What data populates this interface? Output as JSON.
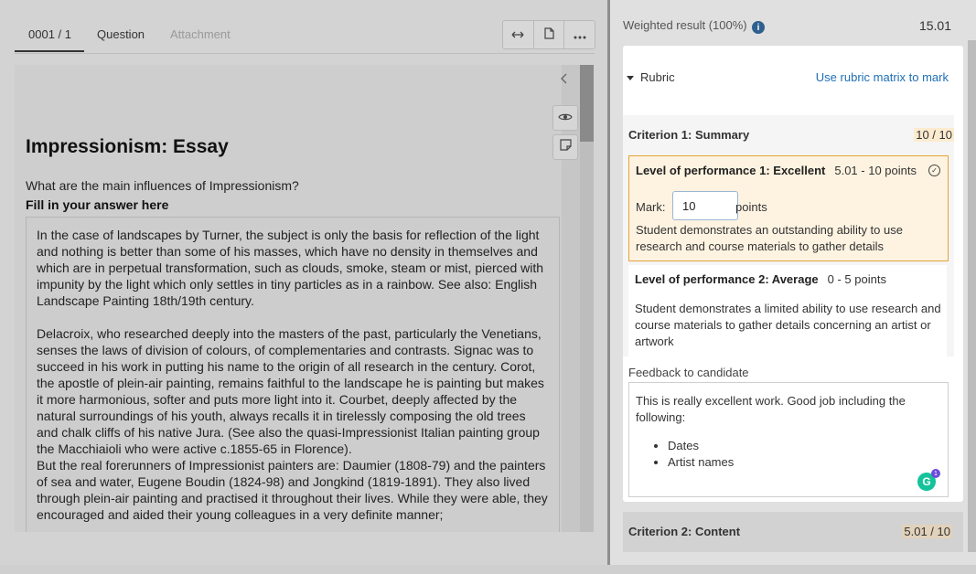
{
  "tabs": {
    "active": "0001 / 1",
    "question": "Question",
    "attachment": "Attachment"
  },
  "toolbar": {
    "icons": [
      "expand-horizontal-icon",
      "document-icon",
      "more-icon"
    ]
  },
  "side_controls": {
    "icons": [
      "chevron-left-icon",
      "eye-icon",
      "note-icon"
    ]
  },
  "essay": {
    "title": "Impressionism: Essay",
    "question": "What are the main influences of Impressionism?",
    "fill_label": "Fill in your answer here",
    "paragraphs": [
      "In the case of landscapes by Turner, the subject is only the basis for reflection of the light and nothing is better than some of his masses, which have no density in themselves and which are in perpetual transformation, such as clouds, smoke, steam or mist, pierced with impunity by the light which only settles in tiny particles as in a rainbow. See also: English Landscape Painting 18th/19th century.",
      "Delacroix, who researched deeply into the masters of the past, particularly the Venetians, senses the laws of division of colours, of complementaries and contrasts. Signac was to succeed in his work in putting his name to the origin of all research in the century. Corot, the apostle of plein-air painting, remains faithful to the landscape he is painting but makes it more harmonious, softer and puts more light into it. Courbet, deeply affected by the natural surroundings of his youth, always recalls it in tirelessly composing the old trees and chalk cliffs of his native Jura. (See also the quasi-Impressionist Italian painting group the Macchiaioli who were active c.1855-65 in Florence).",
      "But the real forerunners of Impressionist painters are: Daumier (1808-79) and the painters of sea and water, Eugene Boudin (1824-98) and Jongkind (1819-1891). They also lived through plein-air painting and practised it throughout their lives. While they were able, they encouraged and aided their young colleagues in a very definite manner;"
    ]
  },
  "result": {
    "label": "Weighted result (100%)",
    "value": "15.01"
  },
  "rubric": {
    "toggle_label": "Rubric",
    "matrix_link": "Use rubric matrix to mark",
    "criteria": [
      {
        "title": "Criterion 1: Summary",
        "score": "10 / 10",
        "levels": [
          {
            "title": "Level of performance 1: Excellent",
            "points": "5.01 - 10 points",
            "selected": true,
            "mark_label": "Mark:",
            "mark_value": "10",
            "mark_unit": "points",
            "description": "Student demonstrates an outstanding ability to use research and course materials to gather details"
          },
          {
            "title": "Level of performance 2: Average",
            "points": "0 - 5 points",
            "selected": false,
            "description": "Student demonstrates a limited ability to use research and course materials to gather details concerning an artist or artwork"
          }
        ]
      },
      {
        "title": "Criterion 2: Content",
        "score": "5.01 / 10"
      }
    ]
  },
  "feedback": {
    "label": "Feedback to candidate",
    "text": "This is really excellent work. Good job including the following:",
    "items": [
      "Dates",
      "Artist names"
    ],
    "grammarly_count": "1"
  },
  "colors": {
    "link": "#1e6fb5",
    "selected_border": "#e2a53a",
    "selected_bg": "#fef3e1",
    "info_icon": "#2f5f8f",
    "grammarly": "#15c39a"
  }
}
